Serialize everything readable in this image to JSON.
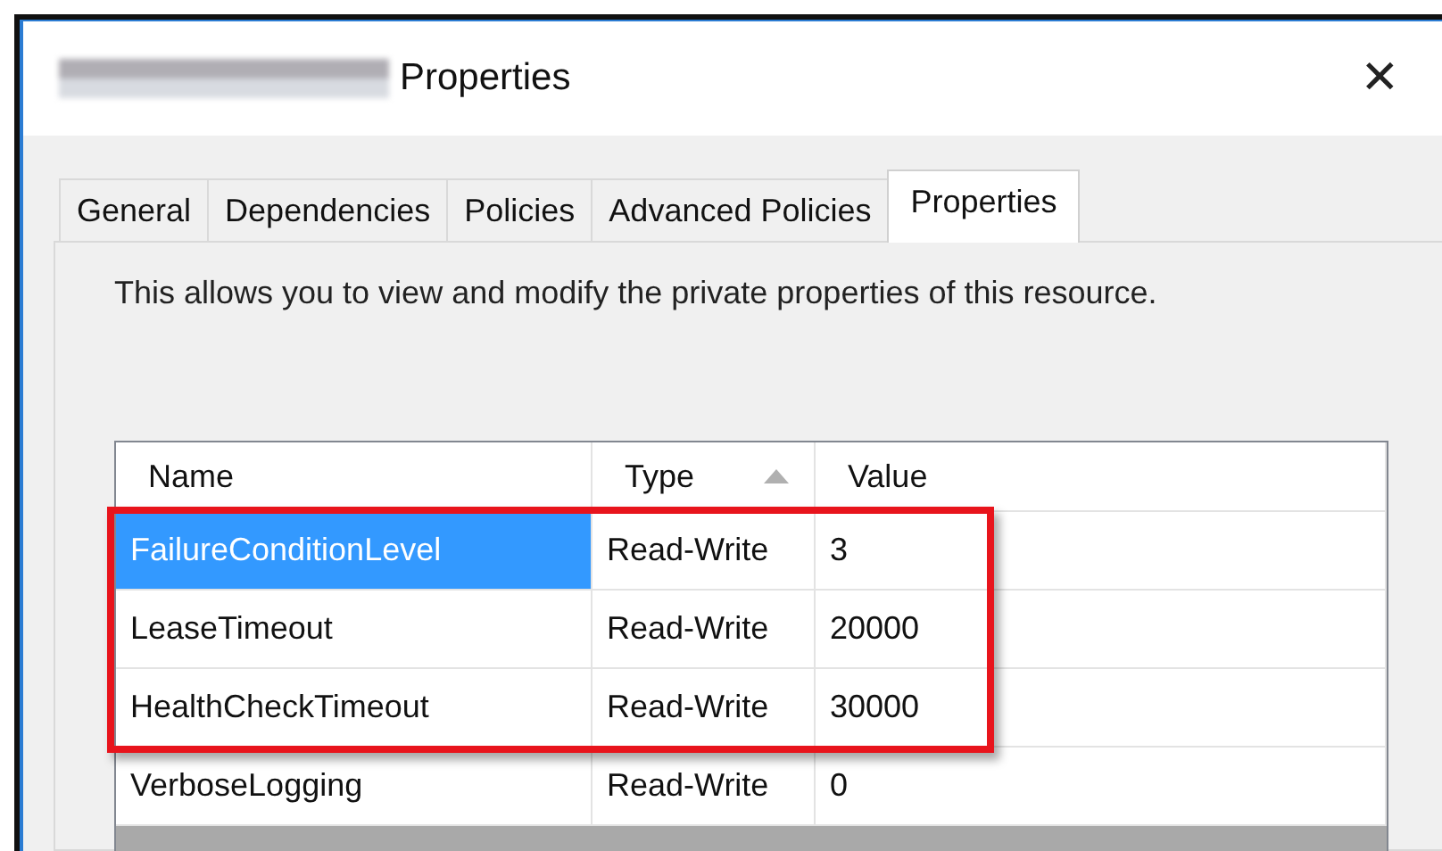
{
  "window": {
    "title": "Properties",
    "close": "✕"
  },
  "tabs": [
    {
      "label": "General",
      "selected": false
    },
    {
      "label": "Dependencies",
      "selected": false
    },
    {
      "label": "Policies",
      "selected": false
    },
    {
      "label": "Advanced Policies",
      "selected": false
    },
    {
      "label": "Properties",
      "selected": true
    }
  ],
  "description": "This allows you to view and modify the private properties of this resource.",
  "table": {
    "columns": [
      {
        "label": "Name",
        "sorted": false
      },
      {
        "label": "Type",
        "sorted": true
      },
      {
        "label": "Value",
        "sorted": false
      }
    ],
    "rows": [
      {
        "name": "FailureConditionLevel",
        "type": "Read-Write",
        "value": "3",
        "selected": true,
        "highlighted": true
      },
      {
        "name": "LeaseTimeout",
        "type": "Read-Write",
        "value": "20000",
        "selected": false,
        "highlighted": true
      },
      {
        "name": "HealthCheckTimeout",
        "type": "Read-Write",
        "value": "30000",
        "selected": false,
        "highlighted": true
      },
      {
        "name": "VerboseLogging",
        "type": "Read-Write",
        "value": "0",
        "selected": false,
        "highlighted": false
      }
    ]
  }
}
